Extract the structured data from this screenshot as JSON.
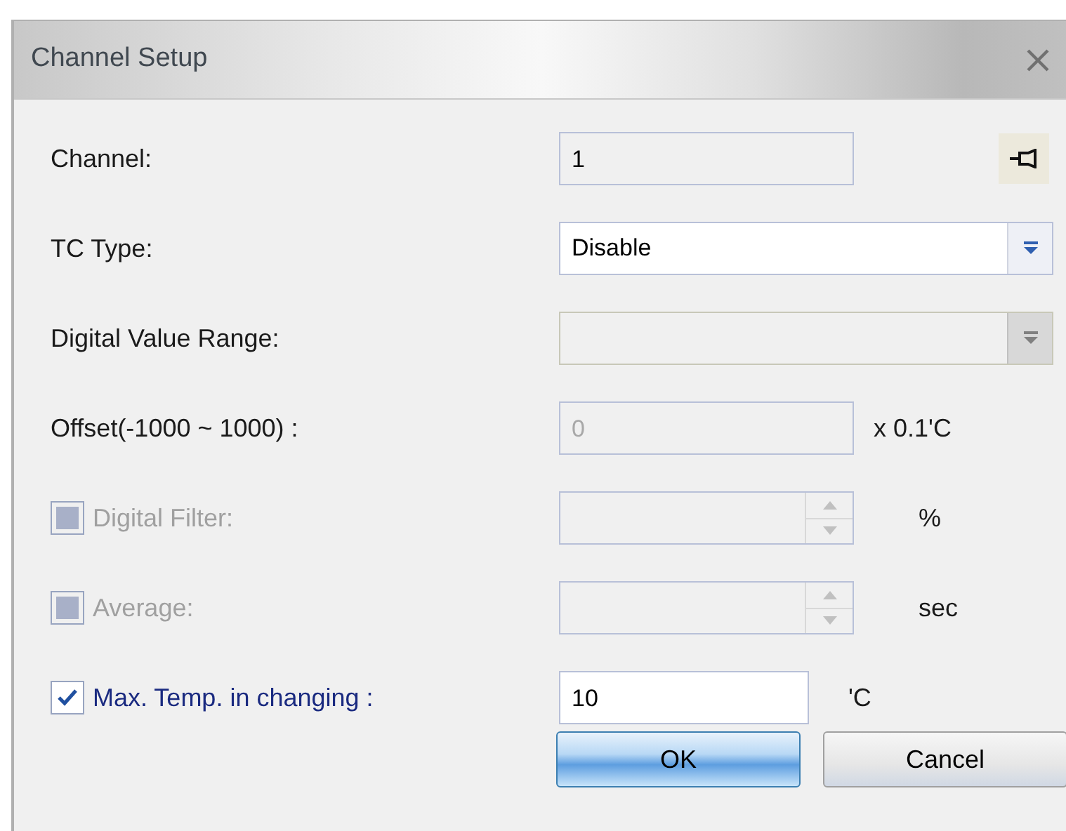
{
  "window": {
    "title": "Channel Setup"
  },
  "rows": [
    {
      "kind": "readonly",
      "label": "Channel:",
      "value": "1",
      "disabled": false
    },
    {
      "kind": "dropdown",
      "label": "TC Type:",
      "value": "Disable",
      "disabled": false
    },
    {
      "kind": "dropdown",
      "label": "Digital Value Range:",
      "disabled": true
    },
    {
      "kind": "field",
      "label": "Offset(-1000 ~ 1000) :",
      "value": "0",
      "unit": "x 0.1'C",
      "disabled": true
    },
    {
      "kind": "spin",
      "label": "Digital Filter:",
      "checked": false,
      "unit": "%",
      "disabled": true
    },
    {
      "kind": "spin",
      "label": "Average:",
      "checked": false,
      "unit": "sec",
      "disabled": true
    },
    {
      "kind": "field",
      "label": "Max. Temp. in changing :",
      "checked": true,
      "value": "10",
      "unit": "'C",
      "disabled": false
    }
  ],
  "buttons": [
    {
      "label": "OK",
      "selected": true
    },
    {
      "label": "Cancel",
      "selected": false
    }
  ]
}
